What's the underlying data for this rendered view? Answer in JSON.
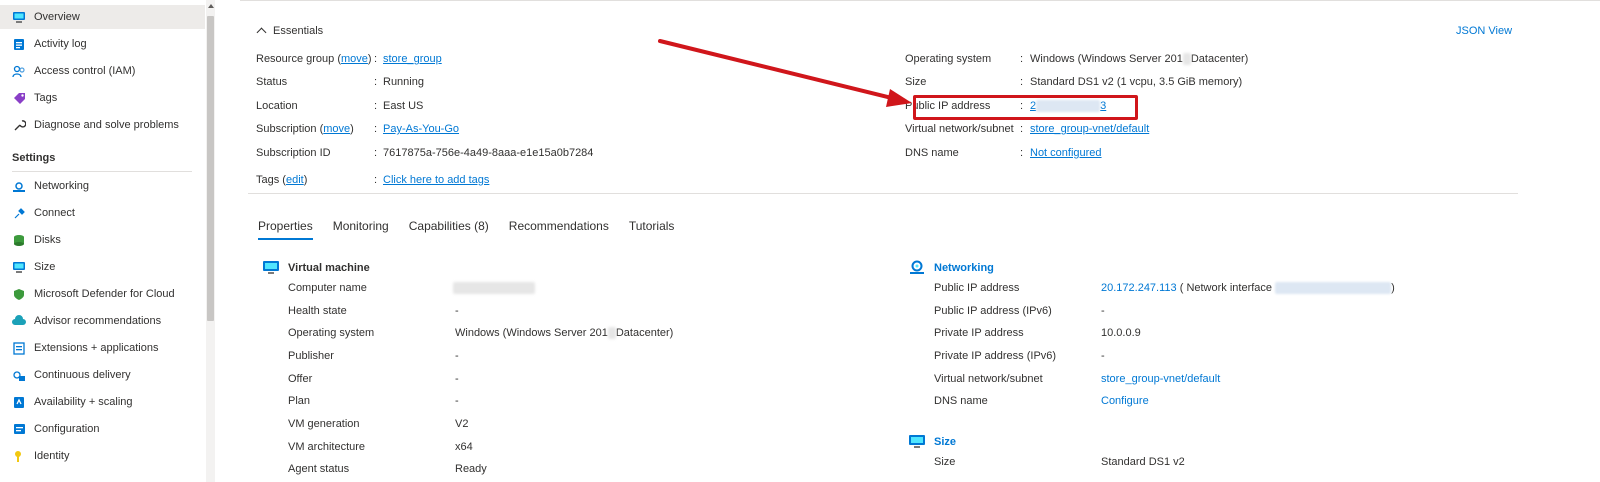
{
  "sidebar": {
    "items": [
      {
        "label": "Overview",
        "icon": "monitor-icon"
      },
      {
        "label": "Activity log",
        "icon": "log-icon"
      },
      {
        "label": "Access control (IAM)",
        "icon": "people-icon"
      },
      {
        "label": "Tags",
        "icon": "tag-icon"
      },
      {
        "label": "Diagnose and solve problems",
        "icon": "wrench-icon"
      }
    ],
    "settings_header": "Settings",
    "settings_items": [
      {
        "label": "Networking",
        "icon": "network-icon"
      },
      {
        "label": "Connect",
        "icon": "plug-icon"
      },
      {
        "label": "Disks",
        "icon": "disk-icon"
      },
      {
        "label": "Size",
        "icon": "monitor-icon"
      },
      {
        "label": "Microsoft Defender for Cloud",
        "icon": "shield-icon"
      },
      {
        "label": "Advisor recommendations",
        "icon": "cloud-icon"
      },
      {
        "label": "Extensions + applications",
        "icon": "extension-icon"
      },
      {
        "label": "Continuous delivery",
        "icon": "delivery-icon"
      },
      {
        "label": "Availability + scaling",
        "icon": "scaling-icon"
      },
      {
        "label": "Configuration",
        "icon": "config-icon"
      },
      {
        "label": "Identity",
        "icon": "key-icon"
      }
    ]
  },
  "essentials": {
    "toggle_label": "Essentials",
    "json_view": "JSON View",
    "left": {
      "resource_group_label": "Resource group (",
      "move1": "move",
      "close_paren": ")",
      "resource_group_value": "store_group",
      "status_label": "Status",
      "status_value": "Running",
      "location_label": "Location",
      "location_value": "East US",
      "subscription_label": "Subscription (",
      "move2": "move",
      "subscription_value": "Pay-As-You-Go",
      "subscription_id_label": "Subscription ID",
      "subscription_id_value": "7617875a-756e-4a49-8aaa-e1e15a0b7284",
      "tags_label": "Tags (",
      "edit": "edit",
      "tags_value": "Click here to add tags"
    },
    "right": {
      "os_label": "Operating system",
      "os_value_a": "Windows (Windows Server 201",
      "os_value_b": "Datacenter)",
      "size_label": "Size",
      "size_value": "Standard DS1 v2 (1 vcpu, 3.5 GiB memory)",
      "public_ip_label": "Public IP address",
      "public_ip_value_a": "2",
      "public_ip_value_b": "3",
      "vnet_label": "Virtual network/subnet",
      "vnet_value": "store_group-vnet/default",
      "dns_label": "DNS name",
      "dns_value": "Not configured"
    },
    "colon": ":"
  },
  "tabs": [
    "Properties",
    "Monitoring",
    "Capabilities (8)",
    "Recommendations",
    "Tutorials"
  ],
  "vm_section": {
    "title": "Virtual machine",
    "rows": [
      {
        "label": "Computer name",
        "value": ""
      },
      {
        "label": "Health state",
        "value": "-"
      },
      {
        "label": "Operating system",
        "value": "Windows (Windows Server 201",
        "value_b": "Datacenter)"
      },
      {
        "label": "Publisher",
        "value": "-"
      },
      {
        "label": "Offer",
        "value": "-"
      },
      {
        "label": "Plan",
        "value": "-"
      },
      {
        "label": "VM generation",
        "value": "V2"
      },
      {
        "label": "VM architecture",
        "value": "x64"
      },
      {
        "label": "Agent status",
        "value": "Ready"
      }
    ]
  },
  "net_section": {
    "title": "Networking",
    "public_ip_label": "Public IP address",
    "public_ip_value": "20.172.247.113",
    "nic_text_a": "( Network interface",
    "nic_text_b": ")",
    "rows": [
      {
        "label": "Public IP address (IPv6)",
        "value": "-"
      },
      {
        "label": "Private IP address",
        "value": "10.0.0.9"
      },
      {
        "label": "Private IP address (IPv6)",
        "value": "-"
      }
    ],
    "vnet_label": "Virtual network/subnet",
    "vnet_value": "store_group-vnet/default",
    "dns_label": "DNS name",
    "dns_value": "Configure"
  },
  "size_section": {
    "title": "Size",
    "size_label": "Size",
    "size_value": "Standard DS1 v2"
  },
  "colors": {
    "accent": "#0078d4",
    "highlight": "#d0161b"
  }
}
